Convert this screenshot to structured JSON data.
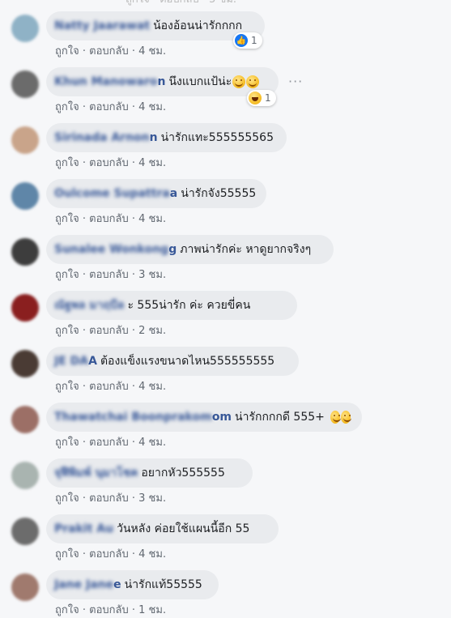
{
  "comments": [
    {
      "name": "Natty Jaarawat",
      "name_tail": "",
      "text": "น้องอ้อนน่ารักกกก",
      "like": "ถูกใจ",
      "reply": "ตอบกลับ",
      "time": "4 ชม.",
      "reaction_count": "1",
      "reaction_type": "like"
    },
    {
      "name": "Khun Manowaro",
      "name_tail": "n",
      "text": "นึงแบกแป้น่ะ",
      "like": "ถูกใจ",
      "reply": "ตอบกลับ",
      "time": "4 ชม.",
      "reaction_count": "1",
      "reaction_type": "haha"
    },
    {
      "name": "Sirinada Arnon",
      "name_tail": "n",
      "text": "น่ารักแทะ555555565",
      "like": "ถูกใจ",
      "reply": "ตอบกลับ",
      "time": "4 ชม."
    },
    {
      "name": "Oulcome Supattra",
      "name_tail": "a",
      "text": "น่ารักจัง55555",
      "like": "ถูกใจ",
      "reply": "ตอบกลับ",
      "time": "4 ชม."
    },
    {
      "name": "Sunalee Wonkong",
      "name_tail": "g",
      "text": "ภาพน่ารักค่ะ หาดูยากจริงๆ",
      "like": "ถูกใจ",
      "reply": "ตอบกลับ",
      "time": "3 ชม."
    },
    {
      "name": "ณัฐพล มาฤบีล",
      "name_tail": "",
      "text": "ะ 555น่ารัก ค่ะ ควยขี่คน",
      "like": "ถูกใจ",
      "reply": "ตอบกลับ",
      "time": "2 ชม."
    },
    {
      "name": "JE DA",
      "name_tail": "A",
      "text": "ต้องแข็งแรงขนาดไหน555555555",
      "like": "ถูกใจ",
      "reply": "ตอบกลับ",
      "time": "4 ชม."
    },
    {
      "name": "Thawatchai Boonprakom",
      "name_tail": "om",
      "text": "น่ารักกกกดี 555+",
      "like": "ถูกใจ",
      "reply": "ตอบกลับ",
      "time": "4 ชม."
    },
    {
      "name": "จุฬีพิมพ์ นุมาโชค",
      "name_tail": "",
      "text": "อยากหัว555555",
      "like": "ถูกใจ",
      "reply": "ตอบกลับ",
      "time": "3 ชม."
    },
    {
      "name": "Prakit Au",
      "name_tail": "",
      "text": "วันหลัง ค่อยใช้แผนนี้อีก 55",
      "like": "ถูกใจ",
      "reply": "ตอบกลับ",
      "time": "4 ชม."
    },
    {
      "name": "Jane Jane",
      "name_tail": "e",
      "text": "น่ารักแท้55555",
      "like": "ถูกใจ",
      "reply": "ตอบกลับ",
      "time": "1 ชม."
    }
  ],
  "meta_separator": "·",
  "more_glyph": "···",
  "colors": {
    "name": "#385898",
    "bubble": "#e9ebee",
    "meta": "#606770",
    "like": "#1877f2"
  }
}
